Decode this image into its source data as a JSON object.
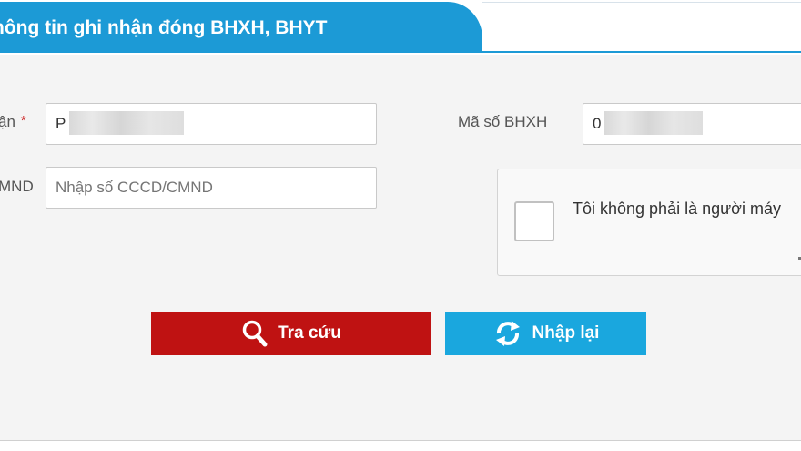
{
  "header": {
    "tab_title": "hông tin ghi nhận đóng BHXH, BHYT"
  },
  "form": {
    "name_label_partial": "ận",
    "name_required_mark": "*",
    "name_value_visible": "P",
    "id_label_partial": "MND",
    "id_placeholder": "Nhập số CCCD/CMND",
    "bhxh_label": "Mã số BHXH",
    "bhxh_value_visible": "0"
  },
  "captcha": {
    "label": "Tôi không phải là người máy"
  },
  "buttons": {
    "search_label": "Tra cứu",
    "search_icon": "search-icon",
    "reset_label": "Nhập lại",
    "reset_icon": "refresh-icon"
  },
  "colors": {
    "primary_blue": "#1c9ad6",
    "search_red": "#bf1212",
    "reset_blue": "#1aa7de",
    "panel_bg": "#f4f4f4"
  }
}
